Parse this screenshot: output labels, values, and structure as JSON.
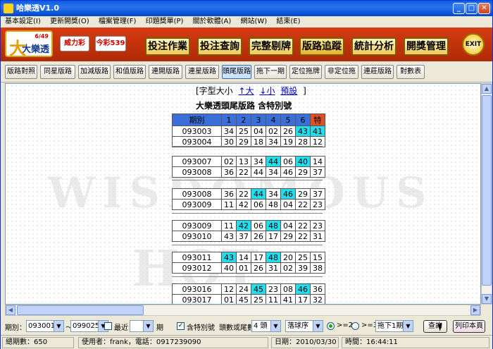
{
  "window": {
    "title": "哈樂透V1.0"
  },
  "menu": [
    "基本設定(I)",
    "更新開獎(O)",
    "檔案管理(F)",
    "印題獎單(P)",
    "關於軟體(A)",
    "網站(W)",
    "結束(E)"
  ],
  "toolbar": {
    "logo_main": "大樂透",
    "logo_main_small": "6/49",
    "logo2": "威力彩",
    "logo3": "今彩539",
    "buttons": [
      "投注作業",
      "投注查詢",
      "完整剔牌",
      "版路追蹤",
      "統計分析",
      "開獎管理"
    ],
    "exit": "EXIT"
  },
  "subtabs": [
    "版路對照",
    "同星版路",
    "加減版路",
    "和值版路",
    "連開版路",
    "連星版路",
    "頭尾版路",
    "拖下一期",
    "定位拖牌",
    "非定位拖",
    "連莊版路",
    "對數表"
  ],
  "selected_subtab": "頭尾版路",
  "content": {
    "font_line_prefix": "[字型大小",
    "font_big": "↑大",
    "font_small": "↓小",
    "font_default": "預設",
    "font_line_suffix": "]",
    "title": "大樂透頭尾版路 含特別號",
    "header": [
      "期別",
      "1",
      "2",
      "3",
      "4",
      "5",
      "6",
      "特"
    ],
    "groups": [
      [
        {
          "id": "093003",
          "nums": [
            "34",
            "25",
            "04",
            "02",
            "26",
            "43",
            "41"
          ],
          "hl": [
            5,
            6
          ]
        },
        {
          "id": "093004",
          "nums": [
            "30",
            "29",
            "18",
            "34",
            "19",
            "28",
            "12"
          ],
          "hl": []
        }
      ],
      [
        {
          "id": "093007",
          "nums": [
            "02",
            "13",
            "34",
            "44",
            "06",
            "40",
            "14"
          ],
          "hl": [
            3,
            5
          ]
        },
        {
          "id": "093008",
          "nums": [
            "36",
            "22",
            "44",
            "34",
            "46",
            "29",
            "37"
          ],
          "hl": []
        }
      ],
      [
        {
          "id": "093008",
          "nums": [
            "36",
            "22",
            "44",
            "34",
            "46",
            "29",
            "37"
          ],
          "hl": [
            2,
            4
          ]
        },
        {
          "id": "093009",
          "nums": [
            "11",
            "42",
            "06",
            "48",
            "04",
            "22",
            "23"
          ],
          "hl": []
        }
      ],
      [
        {
          "id": "093009",
          "nums": [
            "11",
            "42",
            "06",
            "48",
            "04",
            "22",
            "23"
          ],
          "hl": [
            1,
            3
          ]
        },
        {
          "id": "093010",
          "nums": [
            "43",
            "37",
            "26",
            "17",
            "29",
            "22",
            "31"
          ],
          "hl": []
        }
      ],
      [
        {
          "id": "093011",
          "nums": [
            "43",
            "14",
            "17",
            "48",
            "20",
            "25",
            "15"
          ],
          "hl": [
            0,
            3
          ]
        },
        {
          "id": "093012",
          "nums": [
            "40",
            "01",
            "26",
            "31",
            "02",
            "39",
            "38"
          ],
          "hl": []
        }
      ],
      [
        {
          "id": "093016",
          "nums": [
            "12",
            "24",
            "45",
            "23",
            "08",
            "46",
            "36"
          ],
          "hl": [
            2,
            5
          ]
        },
        {
          "id": "093017",
          "nums": [
            "01",
            "45",
            "25",
            "11",
            "41",
            "17",
            "32"
          ],
          "hl": []
        }
      ]
    ],
    "watermark1": "WISDOMOUS",
    "watermark2": "HOT"
  },
  "controls": {
    "period_label": "期別：",
    "period_from": "093001",
    "tilde": "～",
    "period_to": "099025",
    "recent_label": "最近",
    "recent_value": "",
    "period_unit": "期",
    "special_label": "含特別號",
    "headtail_label": "頭數或尾數",
    "headtail_value": "4 頭",
    "order_value": "落球序",
    "radio1_label": ">=2",
    "radio2_label": ">=3",
    "drag_value": "拖下1期",
    "query_button": "查詢",
    "print_button": "列印本頁"
  },
  "status": {
    "total": "總期數：650",
    "user": "使用者：frank，電話：0917239090",
    "date": "日期：2010/03/30",
    "time": "時間：16:44:11"
  },
  "colors": {
    "accent": "#22ddee",
    "header": "#3a6fd8",
    "special": "#e05020"
  }
}
